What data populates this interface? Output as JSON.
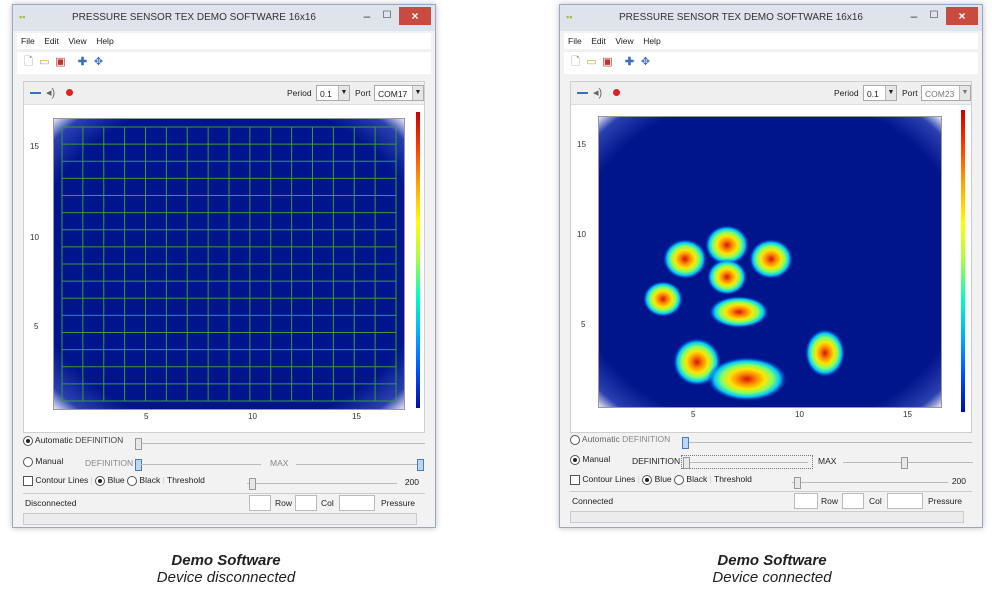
{
  "windows": [
    {
      "title": "PRESSURE SENSOR TEX DEMO SOFTWARE 16x16",
      "menu": [
        "File",
        "Edit",
        "View",
        "Help"
      ],
      "period_label": "Period",
      "period_value": "0.1",
      "port_label": "Port",
      "port_value": "COM17",
      "y_ticks": [
        "15",
        "10",
        "5"
      ],
      "x_ticks": [
        "5",
        "10",
        "15"
      ],
      "automatic_label": "Automatic",
      "definition_label": "DEFINITION",
      "manual_label": "Manual",
      "max_label": "MAX",
      "contour_label": "Contour Lines",
      "blue_label": "Blue",
      "black_label": "Black",
      "threshold_label": "Threshold",
      "threshold_value": "200",
      "status": "Disconnected",
      "row_label": "Row",
      "col_label": "Col",
      "pressure_label": "Pressure",
      "mode": "automatic",
      "heatmap": "grid"
    },
    {
      "title": "PRESSURE SENSOR TEX DEMO SOFTWARE 16x16",
      "menu": [
        "File",
        "Edit",
        "View",
        "Help"
      ],
      "period_label": "Period",
      "period_value": "0.1",
      "port_label": "Port",
      "port_value": "COM23",
      "y_ticks": [
        "15",
        "10",
        "5"
      ],
      "x_ticks": [
        "5",
        "10",
        "15"
      ],
      "automatic_label": "Automatic",
      "definition_label": "DEFINITION",
      "manual_label": "Manual",
      "max_label": "MAX",
      "contour_label": "Contour Lines",
      "blue_label": "Blue",
      "black_label": "Black",
      "threshold_label": "Threshold",
      "threshold_value": "200",
      "status": "Connected",
      "row_label": "Row",
      "col_label": "Col",
      "pressure_label": "Pressure",
      "mode": "manual",
      "heatmap": "blobs"
    }
  ],
  "captions": [
    {
      "title": "Demo Software",
      "sub": "Device disconnected"
    },
    {
      "title": "Demo Software",
      "sub": "Device connected"
    }
  ],
  "colors": {
    "plot_background": "#00148c",
    "grid_line": "#3a9a3a",
    "accent": "#3b6fb6",
    "close_button": "#c94a3e"
  }
}
